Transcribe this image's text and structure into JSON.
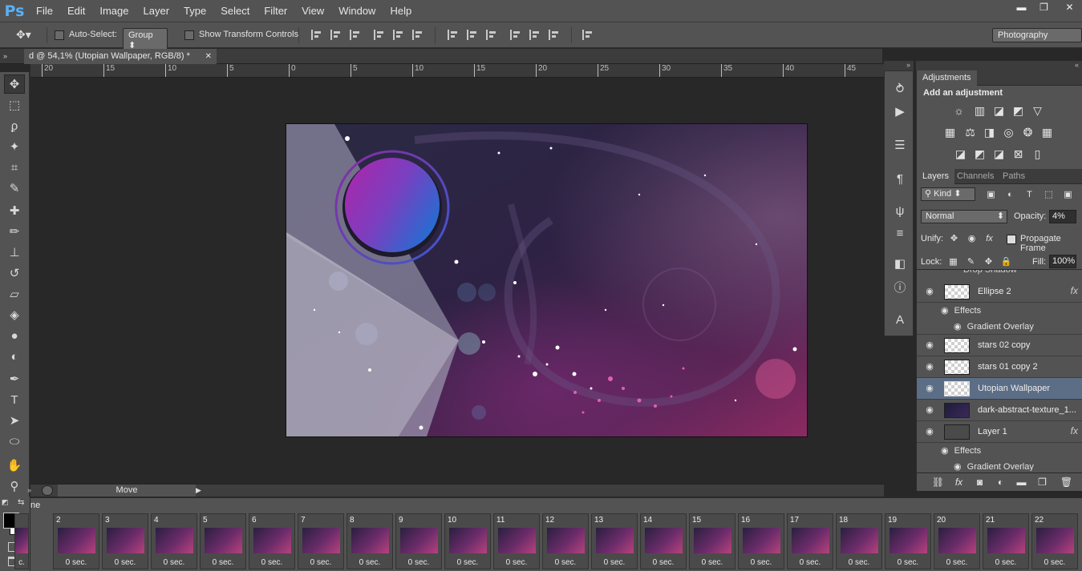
{
  "app": {
    "logo": "Ps"
  },
  "menu": [
    "File",
    "Edit",
    "Image",
    "Layer",
    "Type",
    "Select",
    "Filter",
    "View",
    "Window",
    "Help"
  ],
  "window_controls": {
    "minimize": "▬",
    "restore": "❐",
    "close": "✕"
  },
  "options": {
    "auto_select_label": "Auto-Select:",
    "auto_select_value": "Group",
    "show_transform_label": "Show Transform Controls",
    "workspace": "Photography"
  },
  "document": {
    "tab_title": "d @ 54,1% (Utopian Wallpaper, RGB/8) *",
    "close_glyph": "✕"
  },
  "ruler": {
    "ticks": [
      "20",
      "15",
      "10",
      "5",
      "0",
      "5",
      "10",
      "15",
      "20",
      "25",
      "30",
      "35",
      "40",
      "45"
    ]
  },
  "status": {
    "label": "Move"
  },
  "adjustments": {
    "tab": "Adjustments",
    "title": "Add an adjustment",
    "icons": [
      "brightness-contrast",
      "levels",
      "curves",
      "exposure",
      "vibrance",
      "hue-saturation",
      "color-balance",
      "black-white",
      "photo-filter",
      "channel-mixer",
      "color-lookup",
      "invert",
      "posterize",
      "threshold",
      "selective-color",
      "gradient-map"
    ]
  },
  "layers_panel": {
    "tabs": [
      "Layers",
      "Channels",
      "Paths"
    ],
    "filter_kind": "Kind",
    "blend_mode": "Normal",
    "opacity_label": "Opacity:",
    "opacity_value": "4%",
    "unify_label": "Unify:",
    "propagate_label": "Propagate Frame",
    "lock_label": "Lock:",
    "fill_label": "Fill:",
    "fill_value": "100%",
    "partial_top": "Drop Shadow",
    "layers": [
      {
        "name": "Ellipse 2",
        "fx": true,
        "effects_label": "Effects",
        "effect": "Gradient Overlay"
      },
      {
        "name": "stars 02 copy"
      },
      {
        "name": "stars 01 copy 2"
      },
      {
        "name": "Utopian Wallpaper",
        "selected": true
      },
      {
        "name": "dark-abstract-texture_1..."
      },
      {
        "name": "Layer 1",
        "fx": true,
        "effects_label": "Effects",
        "effect": "Gradient Overlay"
      }
    ]
  },
  "timeline": {
    "label": "ne",
    "frames": [
      "2",
      "3",
      "4",
      "5",
      "6",
      "7",
      "8",
      "9",
      "10",
      "11",
      "12",
      "13",
      "14",
      "15",
      "16",
      "17",
      "18",
      "19",
      "20",
      "21",
      "22"
    ],
    "delay": "0 sec.",
    "first_delay": "c."
  }
}
